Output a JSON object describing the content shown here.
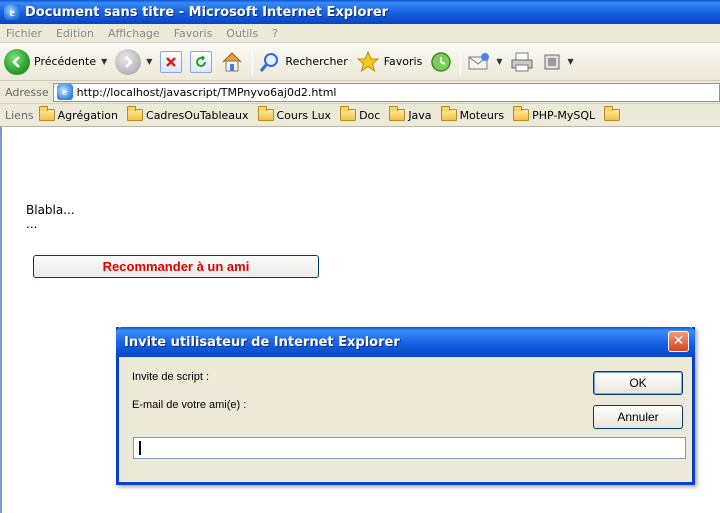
{
  "window": {
    "title": "Document sans titre - Microsoft Internet Explorer",
    "app_icon": "e"
  },
  "menubar": {
    "items": [
      "Fichier",
      "Edition",
      "Affichage",
      "Favoris",
      "Outils",
      "?"
    ]
  },
  "toolbar": {
    "back_label": "Précédente",
    "search_label": "Rechercher",
    "favorites_label": "Favoris"
  },
  "addressbar": {
    "label": "Adresse",
    "url": "http://localhost/javascript/TMPnyvo6aj0d2.html"
  },
  "linksbar": {
    "label": "Liens",
    "items": [
      "Agrégation",
      "CadresOuTableaux",
      "Cours Lux",
      "Doc",
      "Java",
      "Moteurs",
      "PHP-MySQL"
    ]
  },
  "page": {
    "text_line1": "Blabla...",
    "text_line2": "...",
    "recommend_button": "Recommander à un ami"
  },
  "dialog": {
    "title": "Invite utilisateur de Internet Explorer",
    "close_glyph": "✕",
    "script_label": "Invite de script :",
    "prompt_label": "E-mail de votre ami(e) :",
    "ok_label": "OK",
    "cancel_label": "Annuler",
    "input_value": ""
  },
  "colors": {
    "xp_blue": "#0a57d8",
    "chrome_bg": "#ece9d8",
    "recommend_text": "#e00000",
    "close_red": "#d8431c"
  }
}
